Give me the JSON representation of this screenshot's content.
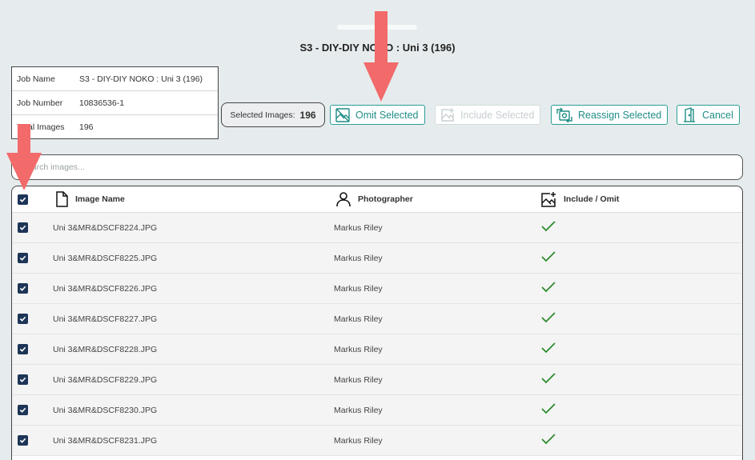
{
  "title": "S3 - DIY-DIY NOKO : Uni 3 (196)",
  "info": [
    {
      "label": "Job Name",
      "value": "S3 - DIY-DIY NOKO : Uni 3 (196)"
    },
    {
      "label": "Job Number",
      "value": "10836536-1"
    },
    {
      "label": "Total Images",
      "value": "196"
    }
  ],
  "selected": {
    "label": "Selected Images:",
    "count": "196"
  },
  "actions": {
    "omit": "Omit Selected",
    "include": "Include Selected",
    "reassign": "Reassign Selected",
    "cancel": "Cancel"
  },
  "search": {
    "placeholder": "Search images..."
  },
  "columns": {
    "name": "Image Name",
    "photographer": "Photographer",
    "include": "Include / Omit"
  },
  "rows": [
    {
      "name": "Uni 3&MR&DSCF8224.JPG",
      "photographer": "Markus Riley",
      "included": true,
      "checked": true
    },
    {
      "name": "Uni 3&MR&DSCF8225.JPG",
      "photographer": "Markus Riley",
      "included": true,
      "checked": true
    },
    {
      "name": "Uni 3&MR&DSCF8226.JPG",
      "photographer": "Markus Riley",
      "included": true,
      "checked": true
    },
    {
      "name": "Uni 3&MR&DSCF8227.JPG",
      "photographer": "Markus Riley",
      "included": true,
      "checked": true
    },
    {
      "name": "Uni 3&MR&DSCF8228.JPG",
      "photographer": "Markus Riley",
      "included": true,
      "checked": true
    },
    {
      "name": "Uni 3&MR&DSCF8229.JPG",
      "photographer": "Markus Riley",
      "included": true,
      "checked": true
    },
    {
      "name": "Uni 3&MR&DSCF8230.JPG",
      "photographer": "Markus Riley",
      "included": true,
      "checked": true
    },
    {
      "name": "Uni 3&MR&DSCF8231.JPG",
      "photographer": "Markus Riley",
      "included": true,
      "checked": true
    }
  ],
  "colors": {
    "accent": "#1f8e86",
    "checkbox": "#1d3557",
    "check_mark": "#2e8b2e",
    "annotation_arrow": "#f26a6a",
    "background": "#e6eced"
  },
  "icons": {
    "omit": "image-off-icon",
    "include": "image-add-icon",
    "reassign": "image-swap-icon",
    "cancel": "door-exit-icon",
    "name_column": "file-icon",
    "photographer_column": "user-icon",
    "include_column": "image-plus-icon",
    "row_status": "checkmark-icon"
  }
}
